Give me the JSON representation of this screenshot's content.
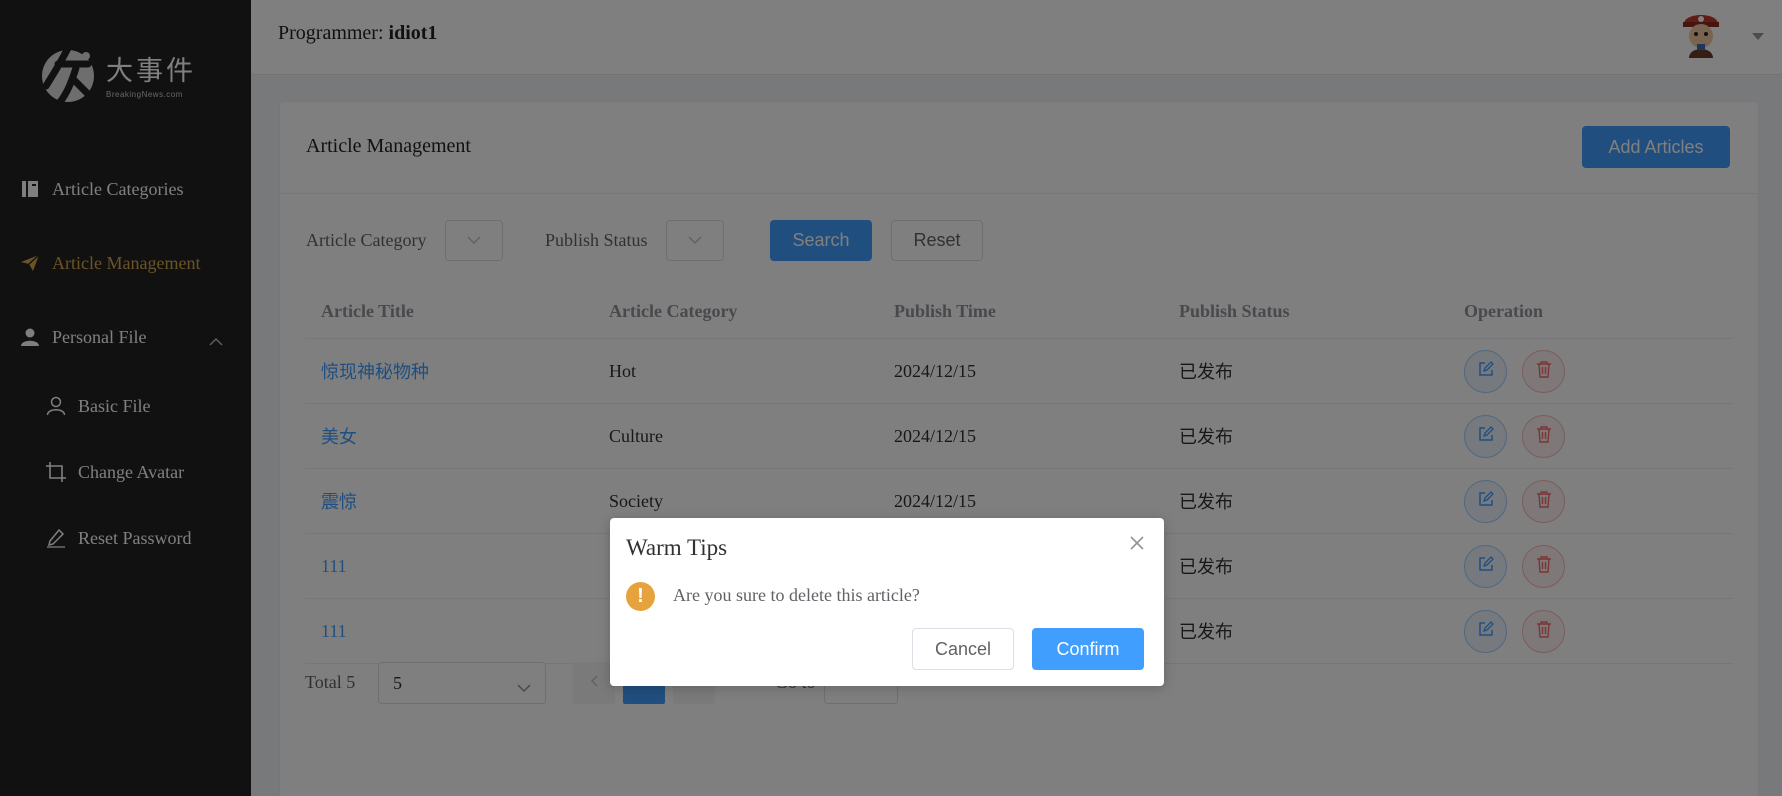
{
  "sidebar": {
    "logo_text": "大事件",
    "logo_sub": "BreakingNews.com",
    "items": [
      {
        "label": "Article Categories",
        "icon": "book-icon"
      },
      {
        "label": "Article Management",
        "icon": "paper-plane-icon",
        "active": true
      },
      {
        "label": "Personal File",
        "icon": "user-icon",
        "expanded": true
      },
      {
        "label": "Basic File",
        "icon": "user-outline-icon"
      },
      {
        "label": "Change Avatar",
        "icon": "crop-icon"
      },
      {
        "label": "Reset Password",
        "icon": "edit-pen-icon"
      }
    ]
  },
  "header": {
    "programmer_label": "Programmer:",
    "programmer_name": "idiot1"
  },
  "card": {
    "title": "Article Management",
    "add_button": "Add Articles"
  },
  "filters": {
    "category_label": "Article Category",
    "status_label": "Publish Status",
    "search_button": "Search",
    "reset_button": "Reset"
  },
  "table": {
    "headers": [
      "Article Title",
      "Article Category",
      "Publish Time",
      "Publish Status",
      "Operation"
    ],
    "rows": [
      {
        "title": "惊现神秘物种",
        "category": "Hot",
        "time": "2024/12/15",
        "status": "已发布"
      },
      {
        "title": "美女",
        "category": "Culture",
        "time": "2024/12/15",
        "status": "已发布"
      },
      {
        "title": "震惊",
        "category": "Society",
        "time": "2024/12/15",
        "status": "已发布"
      },
      {
        "title": "111",
        "category": "",
        "time": "",
        "status": "已发布"
      },
      {
        "title": "111",
        "category": "",
        "time": "",
        "status": "已发布"
      }
    ]
  },
  "pagination": {
    "total": "Total 5",
    "page_size": "5",
    "current_page": "",
    "goto_label": "Go to",
    "goto_value": ""
  },
  "dialog": {
    "title": "Warm Tips",
    "message": "Are you sure to delete this article?",
    "cancel": "Cancel",
    "confirm": "Confirm"
  },
  "colors": {
    "primary": "#409eff",
    "sidebar_bg": "#232323",
    "active_menu": "#d6a74a",
    "warning": "#e6a23c",
    "danger": "#f56c6c"
  }
}
